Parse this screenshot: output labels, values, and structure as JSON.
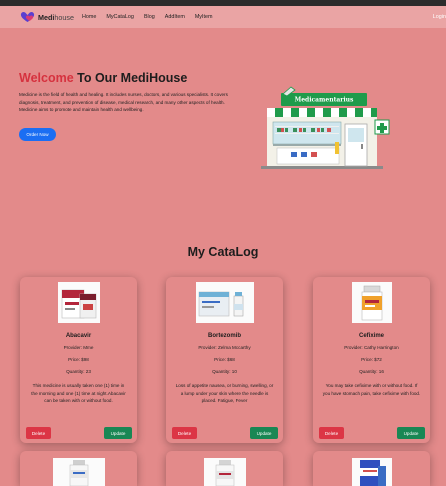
{
  "navbar": {
    "brand_bold": "Medi",
    "brand_thin": "house",
    "links": [
      "Home",
      "MyCataLog",
      "Blog",
      "AddItem",
      "MyItem"
    ],
    "login": "Login",
    "logo_color": "#5a3fd0",
    "heart_color": "#e33b6a"
  },
  "hero": {
    "title_welcome": "Welcome",
    "title_rest": "To Our MediHouse",
    "text": "Medicine is the field of health and healing. It includes nurses, doctors, and various specialists. It covers diagnosis, treatment, and prevention of disease, medical research, and many other aspects of health. Medicine aims to promote and maintain health and wellbeing.",
    "order_button": "Order Now",
    "store_sign": "Medicamentarius"
  },
  "catalog": {
    "title": "My CataLog",
    "items": [
      {
        "name": "Abacavir",
        "provider": "Provider: Mme",
        "price": "Price: $98",
        "quantity": "Quantity: 23",
        "description": "This medicine is usually taken one (1) time in the morning and one (1) time at night.Abacavir can be taken with or without food.",
        "delete_label": "Delete",
        "update_label": "Update"
      },
      {
        "name": "Bortezomib",
        "provider": "Provider: Zelma Mccarthy",
        "price": "Price: $68",
        "quantity": "Quantity: 10",
        "description": "Loss of appetite nausea, or burning, swelling, or a lump under your skin where the needle is placed. Fatigue, Fever",
        "delete_label": "Delete",
        "update_label": "Update"
      },
      {
        "name": "Cefixime",
        "provider": "Provider: Cathy Harrington",
        "price": "Price: $72",
        "quantity": "Quantity: 16",
        "description": "You may take cefixime with or without food. If you have stomach pain, take cefixime with food.",
        "delete_label": "Delete",
        "update_label": "Update"
      }
    ]
  },
  "colors": {
    "background": "#e38a8a",
    "navbar": "#eaa4a4",
    "welcome_red": "#d6323f",
    "order_blue": "#1b6ef3",
    "delete_red": "#dc3545",
    "update_green": "#198754"
  }
}
